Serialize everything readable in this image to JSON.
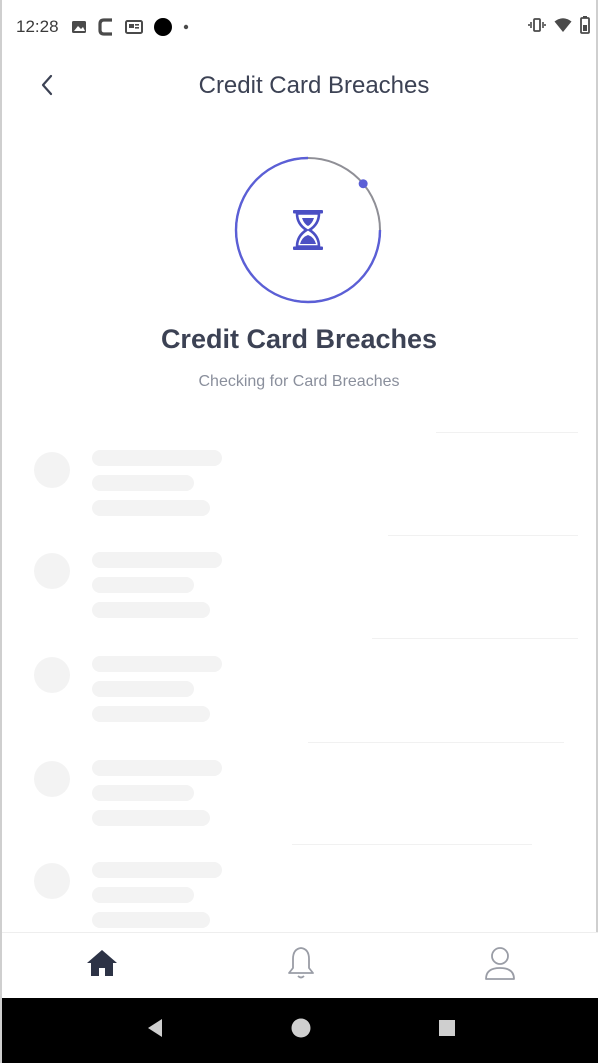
{
  "status_bar": {
    "time": "12:28",
    "left_icons": [
      "image-icon",
      "c-logo-icon",
      "news-icon",
      "record-dot-icon",
      "small-dot-icon"
    ],
    "right_icons": [
      "vibrate-icon",
      "wifi-icon",
      "battery-icon"
    ]
  },
  "header": {
    "title": "Credit Card Breaches",
    "back_icon": "chevron-left-icon"
  },
  "hero": {
    "icon": "hourglass-icon",
    "title": "Credit Card Breaches",
    "subtitle": "Checking for Card Breaches",
    "progress": 0.25,
    "accent_color": "#5b5fd6"
  },
  "skeleton": {
    "item_count": 5
  },
  "bottom_nav": {
    "items": [
      {
        "icon": "home-icon",
        "active": true
      },
      {
        "icon": "bell-icon",
        "active": false
      },
      {
        "icon": "profile-icon",
        "active": false
      }
    ]
  },
  "system_nav": {
    "items": [
      "back-triangle-icon",
      "home-circle-icon",
      "recents-square-icon"
    ]
  }
}
